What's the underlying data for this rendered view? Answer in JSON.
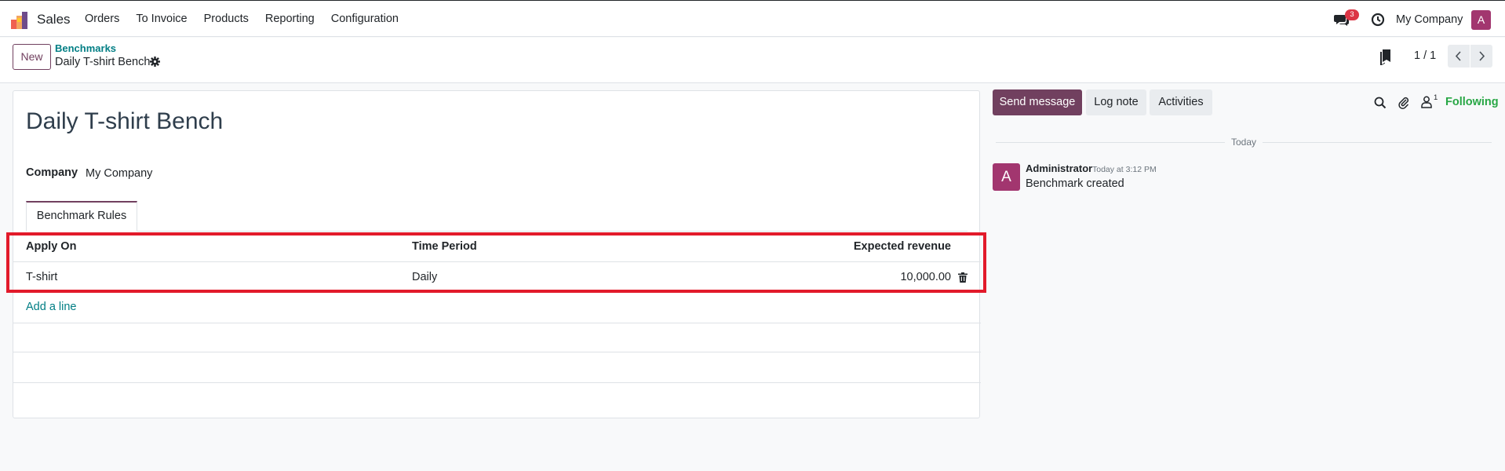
{
  "navbar": {
    "app_name": "Sales",
    "menu": [
      "Orders",
      "To Invoice",
      "Products",
      "Reporting",
      "Configuration"
    ],
    "chat_badge": "3",
    "company": "My Company",
    "avatar_initial": "A"
  },
  "control_panel": {
    "new_label": "New",
    "breadcrumb_parent": "Benchmarks",
    "breadcrumb_current": "Daily T-shirt Bench",
    "pager": "1 / 1"
  },
  "form": {
    "title": "Daily T-shirt Bench",
    "company_label": "Company",
    "company_value": "My Company",
    "tab_label": "Benchmark Rules",
    "columns": [
      "Apply On",
      "Time Period",
      "Expected revenue"
    ],
    "rows": [
      {
        "apply_on": "T-shirt",
        "time_period": "Daily",
        "expected_revenue": "10,000.00"
      }
    ],
    "add_line": "Add a line"
  },
  "chatter": {
    "send_message": "Send message",
    "log_note": "Log note",
    "activities": "Activities",
    "followers_count": "1",
    "following": "Following",
    "day": "Today",
    "message": {
      "avatar_initial": "A",
      "author": "Administrator",
      "date": "Today at 3:12 PM",
      "body": "Benchmark created"
    }
  },
  "colors": {
    "primary": "#71405f",
    "link": "#017e84",
    "highlight": "#e21a2a",
    "following": "#28a745",
    "badge": "#dc3545",
    "avatar": "#a2366f"
  }
}
